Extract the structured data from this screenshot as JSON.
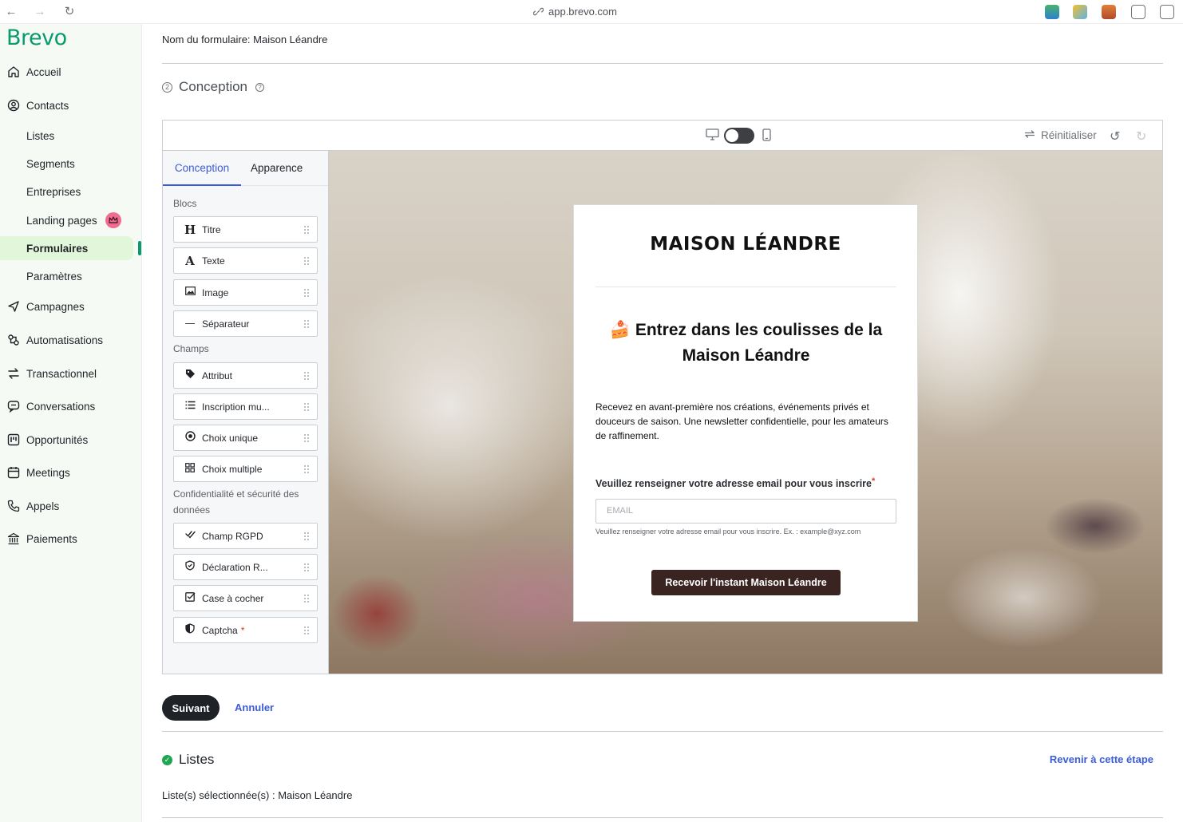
{
  "browser": {
    "url": "app.brevo.com"
  },
  "sidebar": {
    "logo": "Brevo",
    "items": [
      {
        "label": "Accueil",
        "icon": "home-icon"
      },
      {
        "label": "Contacts",
        "icon": "contacts-icon"
      },
      {
        "label": "Listes"
      },
      {
        "label": "Segments"
      },
      {
        "label": "Entreprises"
      },
      {
        "label": "Landing pages",
        "badge_icon": "crown-icon"
      },
      {
        "label": "Formulaires",
        "active": true
      },
      {
        "label": "Paramètres"
      },
      {
        "label": "Campagnes",
        "icon": "send-icon"
      },
      {
        "label": "Automatisations",
        "icon": "automation-icon"
      },
      {
        "label": "Transactionnel",
        "icon": "transactional-icon"
      },
      {
        "label": "Conversations",
        "icon": "chat-icon"
      },
      {
        "label": "Opportunités",
        "icon": "deals-icon"
      },
      {
        "label": "Meetings",
        "icon": "calendar-icon"
      },
      {
        "label": "Appels",
        "icon": "phone-icon"
      },
      {
        "label": "Paiements",
        "icon": "bank-icon"
      }
    ]
  },
  "main": {
    "form_name": "Nom du formulaire: Maison Léandre",
    "step": {
      "number": "2",
      "title": "Conception"
    },
    "toolbar": {
      "reset_label": "Réinitialiser"
    },
    "tabs": [
      "Conception",
      "Apparence"
    ],
    "sections": {
      "blocs": "Blocs",
      "champs": "Champs",
      "privacy": "Confidentialité et sécurité des données"
    },
    "blocks": [
      {
        "label": "Titre",
        "icon": "heading-icon"
      },
      {
        "label": "Texte",
        "icon": "text-icon"
      },
      {
        "label": "Image",
        "icon": "image-icon"
      },
      {
        "label": "Séparateur",
        "icon": "divider-icon"
      }
    ],
    "fields": [
      {
        "label": "Attribut",
        "icon": "tag-icon"
      },
      {
        "label": "Inscription mu...",
        "icon": "list-icon"
      },
      {
        "label": "Choix unique",
        "icon": "radio-icon"
      },
      {
        "label": "Choix multiple",
        "icon": "grid-icon"
      }
    ],
    "privacy_fields": [
      {
        "label": "Champ RGPD",
        "icon": "check-icon"
      },
      {
        "label": "Déclaration R...",
        "icon": "shield-check-icon"
      },
      {
        "label": "Case à cocher",
        "icon": "checkbox-icon"
      },
      {
        "label": "Captcha",
        "icon": "shield-icon",
        "required": "*"
      }
    ],
    "preview": {
      "brand": "MAISON LÉANDRE",
      "title": "🍰 Entrez dans les coulisses de la Maison Léandre",
      "text": "Recevez en avant-première nos créations, événements privés et douceurs de saison. Une newsletter confidentielle, pour les amateurs de raffinement.",
      "field_label": "Veuillez renseigner votre adresse email pour vous inscrire",
      "field_required": "*",
      "email_placeholder": "EMAIL",
      "field_help": "Veuillez renseigner votre adresse email pour vous inscrire. Ex. : example@xyz.com",
      "button": "Recevoir l'instant Maison Léandre"
    },
    "actions": {
      "next": "Suivant",
      "cancel": "Annuler"
    },
    "lists_step": {
      "title": "Listes",
      "back": "Revenir à cette étape",
      "selected": "Liste(s) sélectionnée(s) : Maison Léandre"
    }
  },
  "colors": {
    "brand_green": "#0b996e",
    "link_blue": "#3b5bd9",
    "active_bg": "#e2f7d9",
    "cta_dark": "#3a2421"
  }
}
